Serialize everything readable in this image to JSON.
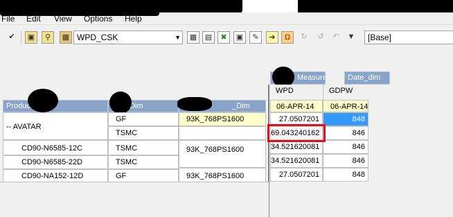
{
  "menu": {
    "file": "File",
    "edit": "Edit",
    "view": "View",
    "options": "Options",
    "help": "Help"
  },
  "toolbar": {
    "selection": "WPD_CSK",
    "base": "[Base]"
  },
  "column_dims": {
    "measure": "Measure",
    "date": "Date_dim"
  },
  "col_headers": {
    "wpd": "WPD",
    "gdpw": "GDPW",
    "date1": "06-APR-14",
    "date2": "06-APR-14"
  },
  "row_headers": {
    "product": "Produc",
    "dim": "Dim",
    "cap": "_Dim"
  },
  "rows": [
    {
      "product": "-- AVATAR",
      "dim": "GF",
      "cap": "93K_768PS1600",
      "wpd": "27.0507201",
      "gdpw": "848"
    },
    {
      "product": "",
      "dim": "TSMC",
      "cap": "",
      "wpd": "69.043240162",
      "gdpw": "846"
    },
    {
      "product": "CD90-N6585-12C",
      "dim": "TSMC",
      "cap": "93K_768PS1600",
      "wpd": "34.521620081",
      "gdpw": "846"
    },
    {
      "product": "CD90-N6585-22D",
      "dim": "TSMC",
      "cap": "",
      "wpd": "34.521620081",
      "gdpw": "846"
    },
    {
      "product": "CD90-NA152-12D",
      "dim": "GF",
      "cap": "93K_768PS1600",
      "wpd": "27.0507201",
      "gdpw": "848"
    }
  ]
}
